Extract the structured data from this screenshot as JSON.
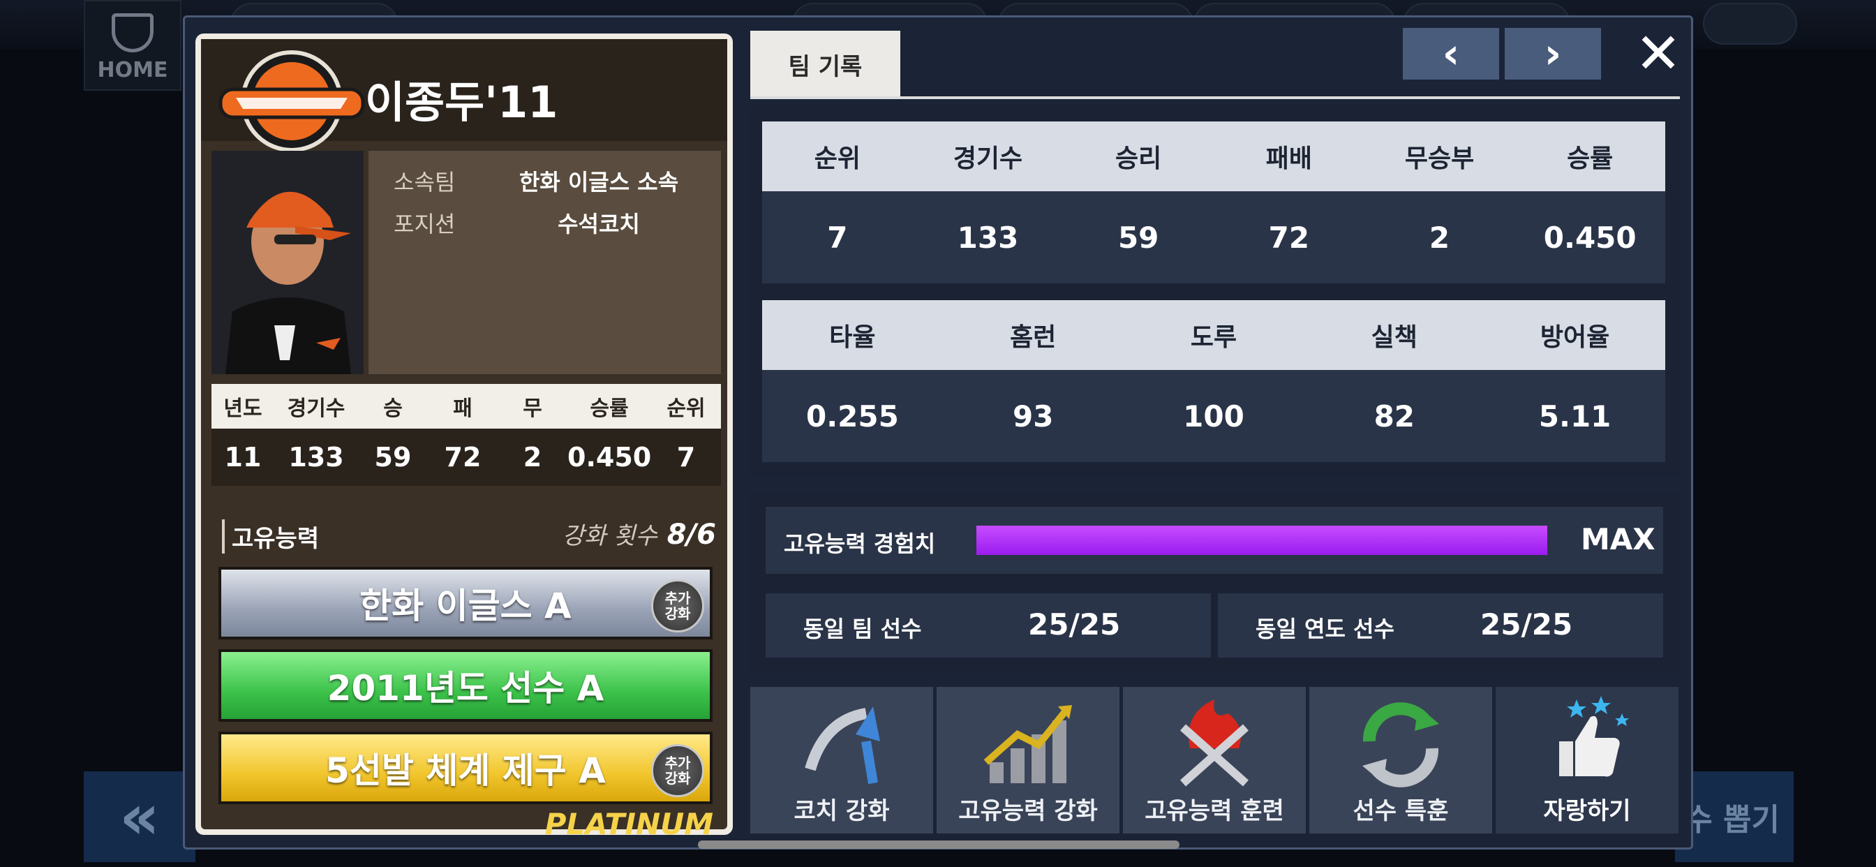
{
  "background": {
    "home_label": "HOME",
    "left_arrow": "«",
    "right_button_text": "수 뽑기"
  },
  "card": {
    "player_name": "이종두'11",
    "info": [
      {
        "label": "소속팀",
        "value": "한화 이글스 소속"
      },
      {
        "label": "포지션",
        "value": "수석코치"
      }
    ],
    "season_headers": [
      "년도",
      "경기수",
      "승",
      "패",
      "무",
      "승률",
      "순위"
    ],
    "season_values": [
      "11",
      "133",
      "59",
      "72",
      "2",
      "0.450",
      "7"
    ],
    "ability_title": "고유능력",
    "enhance_label": "강화 횟수",
    "enhance_value": "8/6",
    "abilities": [
      {
        "name": "한화 이글스 A",
        "badge": "추가\n강화"
      },
      {
        "name": "2011년도 선수 A"
      },
      {
        "name": "5선발 체계 제구 A",
        "badge": "추가\n강화"
      }
    ],
    "grade": "PLATINUM"
  },
  "panel": {
    "tab_label": "팀 기록",
    "prev_icon": "‹",
    "next_icon": "›",
    "close_icon": "✕",
    "table1": {
      "headers": [
        "순위",
        "경기수",
        "승리",
        "패배",
        "무승부",
        "승률"
      ],
      "values": [
        "7",
        "133",
        "59",
        "72",
        "2",
        "0.450"
      ]
    },
    "table2": {
      "headers": [
        "타율",
        "홈런",
        "도루",
        "실책",
        "방어율"
      ],
      "values": [
        "0.255",
        "93",
        "100",
        "82",
        "5.11"
      ]
    },
    "exp": {
      "label": "고유능력 경험치",
      "status": "MAX",
      "fill_fraction": 1.0
    },
    "same_team": {
      "label": "동일 팀 선수",
      "value": "25/25"
    },
    "same_year": {
      "label": "동일 연도 선수",
      "value": "25/25"
    },
    "actions": [
      {
        "label": "코치 강화",
        "icon": "coach-upgrade-icon"
      },
      {
        "label": "고유능력 강화",
        "icon": "growth-chart-icon"
      },
      {
        "label": "고유능력 훈련",
        "icon": "fire-bats-icon"
      },
      {
        "label": "선수 특훈",
        "icon": "refresh-arrows-icon"
      },
      {
        "label": "자랑하기",
        "icon": "thumbs-up-stars-icon"
      }
    ]
  },
  "colors": {
    "exp_bar": "#b53cf7",
    "grade": "#f5d24a",
    "card_bg": "#3a3026"
  }
}
